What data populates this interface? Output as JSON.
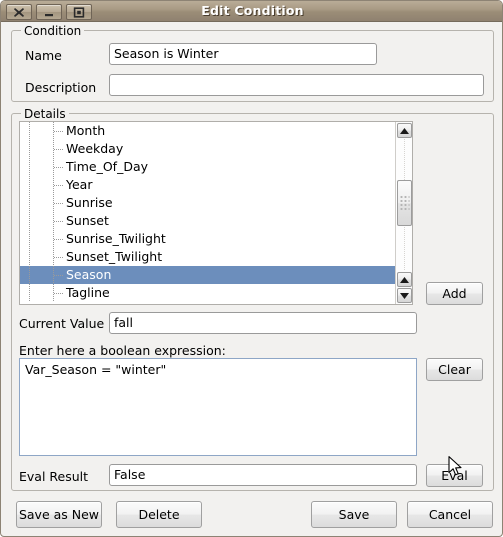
{
  "window": {
    "title": "Edit Condition",
    "controls": [
      {
        "name": "close-button",
        "glyph": "x"
      },
      {
        "name": "minimize-button",
        "glyph": "minus"
      },
      {
        "name": "maximize-button",
        "glyph": "square"
      }
    ]
  },
  "condition_group": {
    "legend": "Condition",
    "name_label": "Name",
    "name_value": "Season is Winter",
    "name_placeholder": "",
    "description_label": "Description",
    "description_value": "",
    "description_placeholder": ""
  },
  "details_group": {
    "legend": "Details",
    "tree_items": [
      {
        "label": "Month",
        "selected": false
      },
      {
        "label": "Weekday",
        "selected": false
      },
      {
        "label": "Time_Of_Day",
        "selected": false
      },
      {
        "label": "Year",
        "selected": false
      },
      {
        "label": "Sunrise",
        "selected": false
      },
      {
        "label": "Sunset",
        "selected": false
      },
      {
        "label": "Sunrise_Twilight",
        "selected": false
      },
      {
        "label": "Sunset_Twilight",
        "selected": false
      },
      {
        "label": "Season",
        "selected": true
      },
      {
        "label": "Tagline",
        "selected": false
      }
    ],
    "add_button": "Add",
    "current_value_label": "Current Value",
    "current_value": "fall",
    "expression_label": "Enter here a boolean expression:",
    "expression_value": "Var_Season = \"winter\"",
    "clear_button": "Clear",
    "eval_result_label": "Eval Result",
    "eval_result_value": "False",
    "eval_button": "Eval"
  },
  "footer": {
    "save_as_new_button": "Save as New",
    "delete_button": "Delete",
    "save_button": "Save",
    "cancel_button": "Cancel"
  },
  "colors": {
    "titlebar_brown": "#a89a84",
    "selection_blue": "#6c8ebc",
    "window_background": "#f2f1ef",
    "expression_border": "#8ea6c6"
  }
}
